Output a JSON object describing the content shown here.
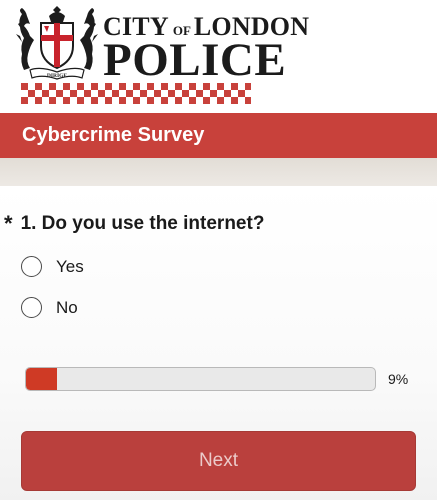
{
  "header": {
    "logo": {
      "line1_city": "CITY",
      "line1_of": "OF",
      "line1_london": "LONDON",
      "line2": "POLICE",
      "crest_motto": "DIRIGE"
    },
    "title": "Cybercrime Survey"
  },
  "question": {
    "required_marker": "*",
    "text": "1. Do you use the internet?",
    "options": [
      {
        "label": "Yes",
        "selected": false
      },
      {
        "label": "No",
        "selected": false
      }
    ]
  },
  "progress": {
    "value_percent": 9,
    "label": "9%"
  },
  "actions": {
    "next_label": "Next"
  },
  "colors": {
    "brand_red": "#c8413b",
    "progress_fill": "#cf3a25",
    "button_bg": "#ba403d"
  },
  "icons": {
    "crest": "city-of-london-crest-icon",
    "radio": "radio-unchecked-icon"
  }
}
